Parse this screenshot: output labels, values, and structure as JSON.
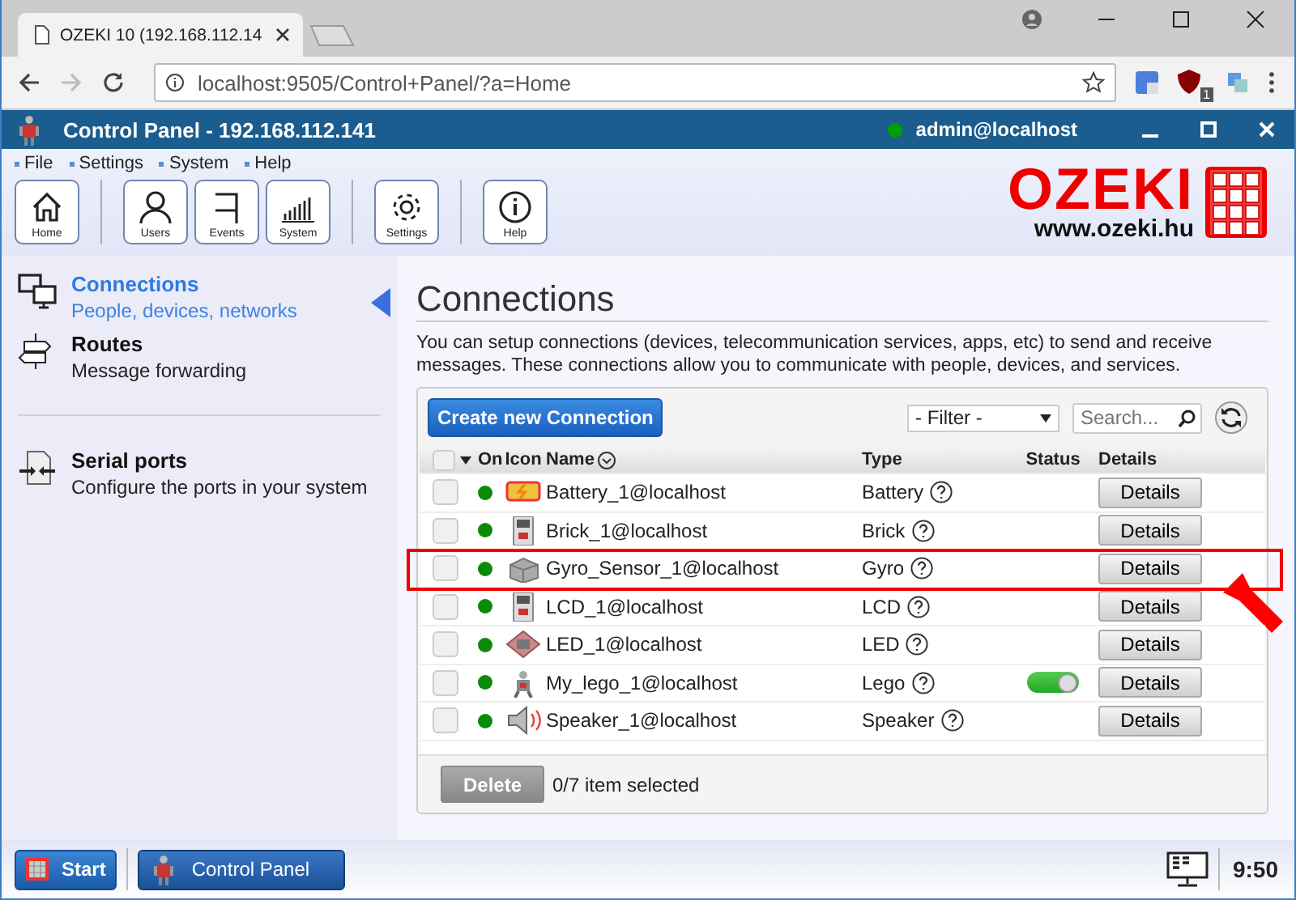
{
  "browser": {
    "tab_title": "OZEKI 10 (192.168.112.14",
    "address": "localhost:9505/Control+Panel/?a=Home",
    "extension_badge": "1"
  },
  "app": {
    "title": "Control Panel - 192.168.112.141",
    "user": "admin@localhost",
    "user_online": true
  },
  "menu": [
    "File",
    "Settings",
    "System",
    "Help"
  ],
  "toolbar": [
    {
      "label": "Home",
      "kind": "home"
    },
    {
      "label": "Users",
      "kind": "user"
    },
    {
      "label": "Events",
      "kind": "flag"
    },
    {
      "label": "System",
      "kind": "bars"
    },
    {
      "label": "Settings",
      "kind": "gear"
    },
    {
      "label": "Help",
      "kind": "info"
    }
  ],
  "logo": {
    "name": "OZEKI",
    "url": "www.ozeki.hu"
  },
  "sidebar": {
    "items": [
      {
        "title": "Connections",
        "subtitle": "People, devices, networks",
        "kind": "connections",
        "selected": true
      },
      {
        "title": "Routes",
        "subtitle": "Message forwarding",
        "kind": "routes",
        "selected": false
      },
      {
        "title": "Serial ports",
        "subtitle": "Configure the ports in your system",
        "kind": "serial",
        "selected": false
      }
    ]
  },
  "content": {
    "title": "Connections",
    "description": "You can setup connections (devices, telecommunication services, apps, etc) to send and receive messages. These connections allow you to communicate with people, devices, and services.",
    "create_button": "Create new Connection",
    "filter": "- Filter -",
    "search_placeholder": "Search...",
    "select_all_checked": false,
    "columns": [
      "On",
      "Icon",
      "Name",
      "Type",
      "Status",
      "Details"
    ],
    "rows": [
      {
        "name": "Battery_1@localhost",
        "type": "Battery",
        "kind": "battery",
        "on": true,
        "checked": false,
        "highlighted": false,
        "details": "Details"
      },
      {
        "name": "Brick_1@localhost",
        "type": "Brick",
        "kind": "brick",
        "on": true,
        "checked": false,
        "highlighted": false,
        "details": "Details"
      },
      {
        "name": "Gyro_Sensor_1@localhost",
        "type": "Gyro",
        "kind": "gyro",
        "on": true,
        "checked": false,
        "highlighted": true,
        "details": "Details"
      },
      {
        "name": "LCD_1@localhost",
        "type": "LCD",
        "kind": "lcd",
        "on": true,
        "checked": false,
        "highlighted": false,
        "details": "Details"
      },
      {
        "name": "LED_1@localhost",
        "type": "LED",
        "kind": "led",
        "on": true,
        "checked": false,
        "highlighted": false,
        "details": "Details"
      },
      {
        "name": "My_lego_1@localhost",
        "type": "Lego",
        "kind": "robot",
        "on": true,
        "checked": false,
        "highlighted": false,
        "switch_on": true,
        "details": "Details"
      },
      {
        "name": "Speaker_1@localhost",
        "type": "Speaker",
        "kind": "speaker",
        "on": true,
        "checked": false,
        "highlighted": false,
        "details": "Details"
      }
    ],
    "delete_button": "Delete",
    "selection_count": "0/7 item selected"
  },
  "taskbar": {
    "start": "Start",
    "windows": [
      {
        "label": "Control Panel",
        "selected": true
      }
    ],
    "clock": "9:50"
  }
}
